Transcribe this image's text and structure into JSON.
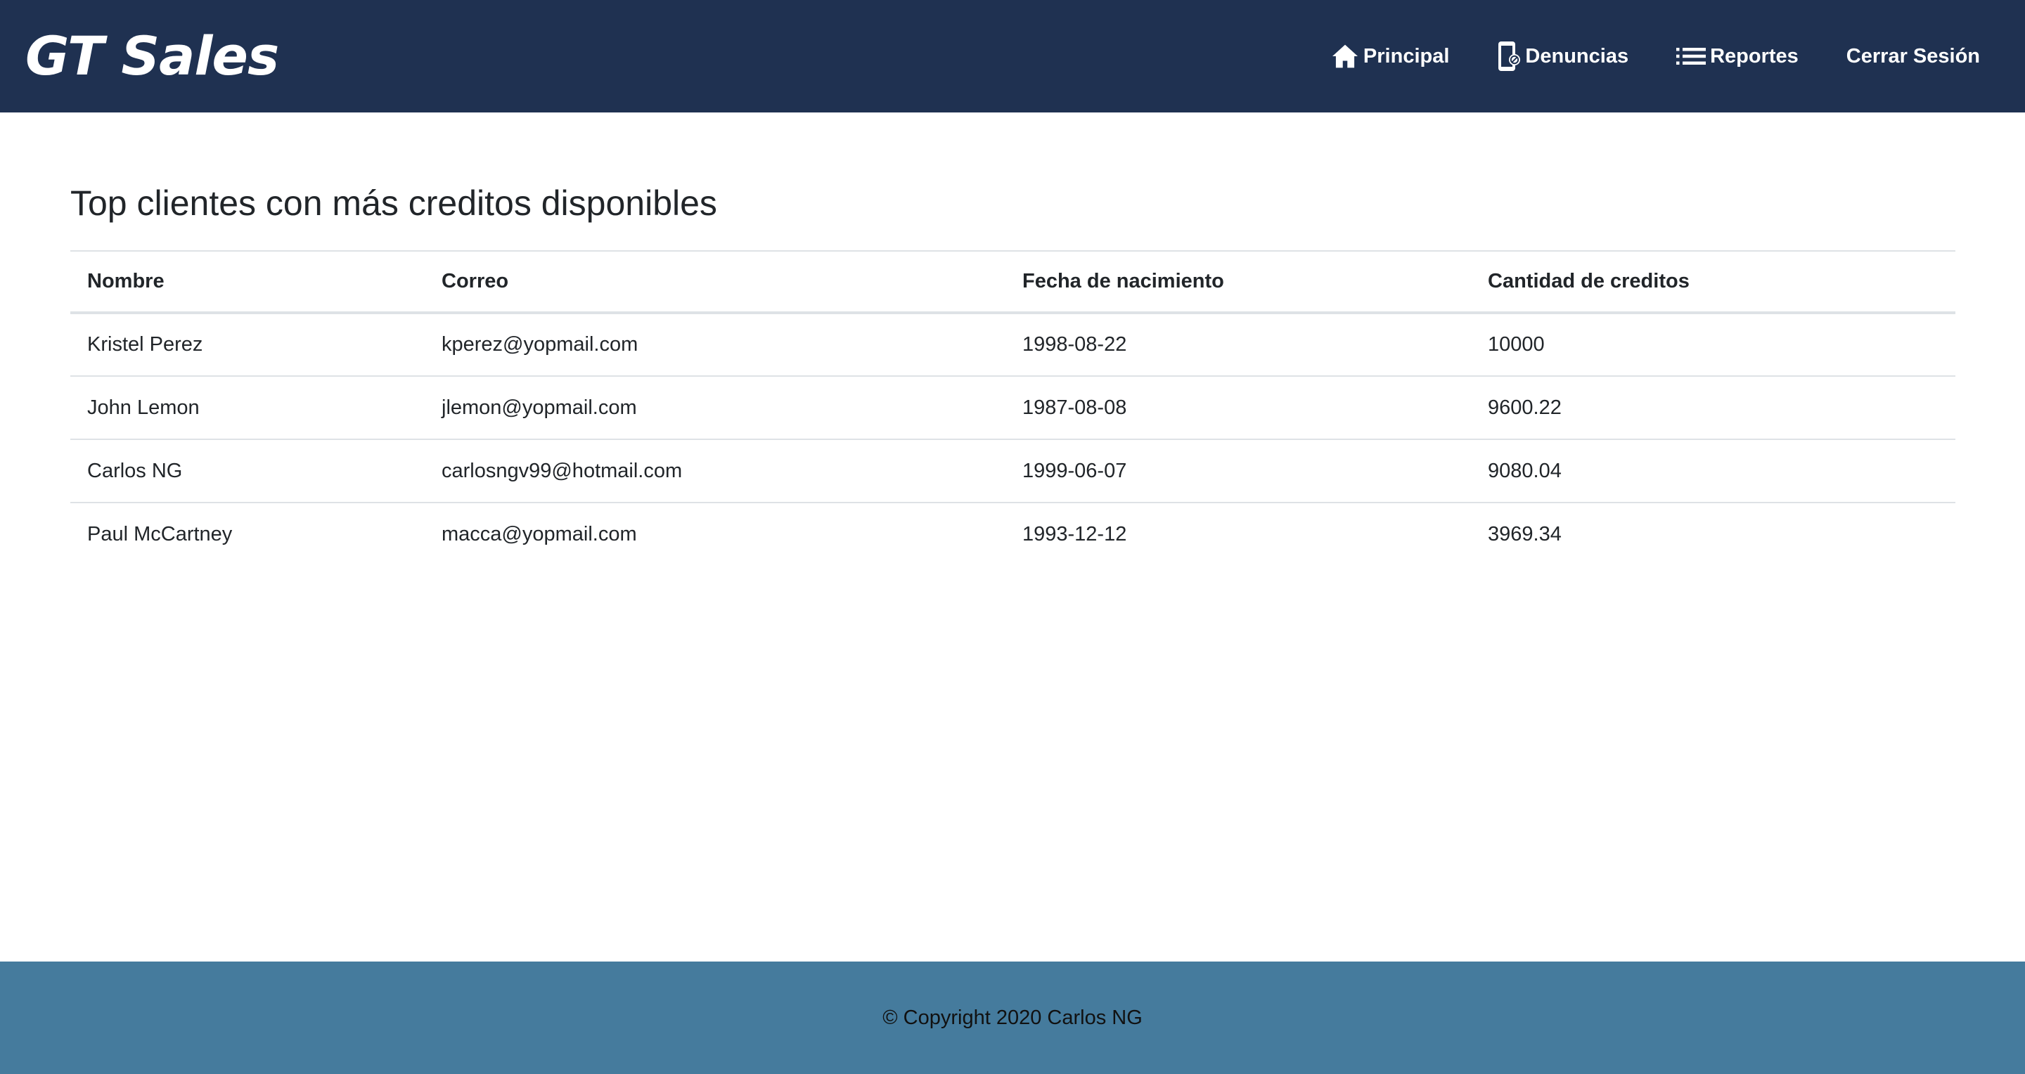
{
  "navbar": {
    "brand": "GT Sales",
    "items": [
      {
        "label": "Principal",
        "icon": "home-icon"
      },
      {
        "label": "Denuncias",
        "icon": "phone-report-icon"
      },
      {
        "label": "Reportes",
        "icon": "list-icon"
      },
      {
        "label": "Cerrar Sesión",
        "icon": ""
      }
    ]
  },
  "main": {
    "title": "Top clientes con más creditos disponibles",
    "table": {
      "headers": [
        "Nombre",
        "Correo",
        "Fecha de nacimiento",
        "Cantidad de creditos"
      ],
      "rows": [
        [
          "Kristel Perez",
          "kperez@yopmail.com",
          "1998-08-22",
          "10000"
        ],
        [
          "John Lemon",
          "jlemon@yopmail.com",
          "1987-08-08",
          "9600.22"
        ],
        [
          "Carlos NG",
          "carlosngv99@hotmail.com",
          "1999-06-07",
          "9080.04"
        ],
        [
          "Paul McCartney",
          "macca@yopmail.com",
          "1993-12-12",
          "3969.34"
        ]
      ]
    }
  },
  "footer": {
    "copyright": "© Copyright 2020 Carlos NG"
  },
  "colors": {
    "navbar_bg": "#1f3151",
    "footer_bg": "#457b9d",
    "text": "#212529",
    "border": "#dee2e6"
  }
}
